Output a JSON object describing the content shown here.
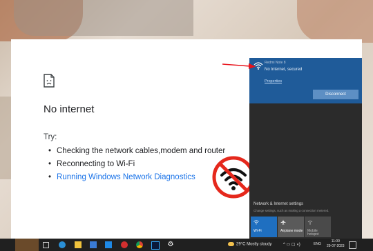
{
  "page": {
    "title": "No internet",
    "try_label": "Try:",
    "suggestions": [
      "Checking the network cables,modem and router",
      "Reconnecting to Wi-Fi",
      "Running Windows Network Diagnostics"
    ]
  },
  "flyout": {
    "network_name": "Redmi Note 8",
    "status": "No Internet, secured",
    "properties_label": "Properties",
    "disconnect_label": "Disconnect",
    "settings_title": "Network & Internet settings",
    "settings_subtitle": "Change settings, such as making a connection metered.",
    "tiles": [
      {
        "label": "Wi-Fi"
      },
      {
        "label": "Airplane mode"
      },
      {
        "label": "Mobile hotspot"
      }
    ]
  },
  "taskbar": {
    "weather": "29°C  Mostly cloudy",
    "language": "ENG",
    "time": "11:00",
    "date": "29-07-2023"
  },
  "colors": {
    "link": "#1a73e8",
    "flyout_bg": "#2b2b2b",
    "connection_card": "#1f5b99",
    "arrow": "#e8131b",
    "no_wifi_badge": "#e5281c"
  }
}
